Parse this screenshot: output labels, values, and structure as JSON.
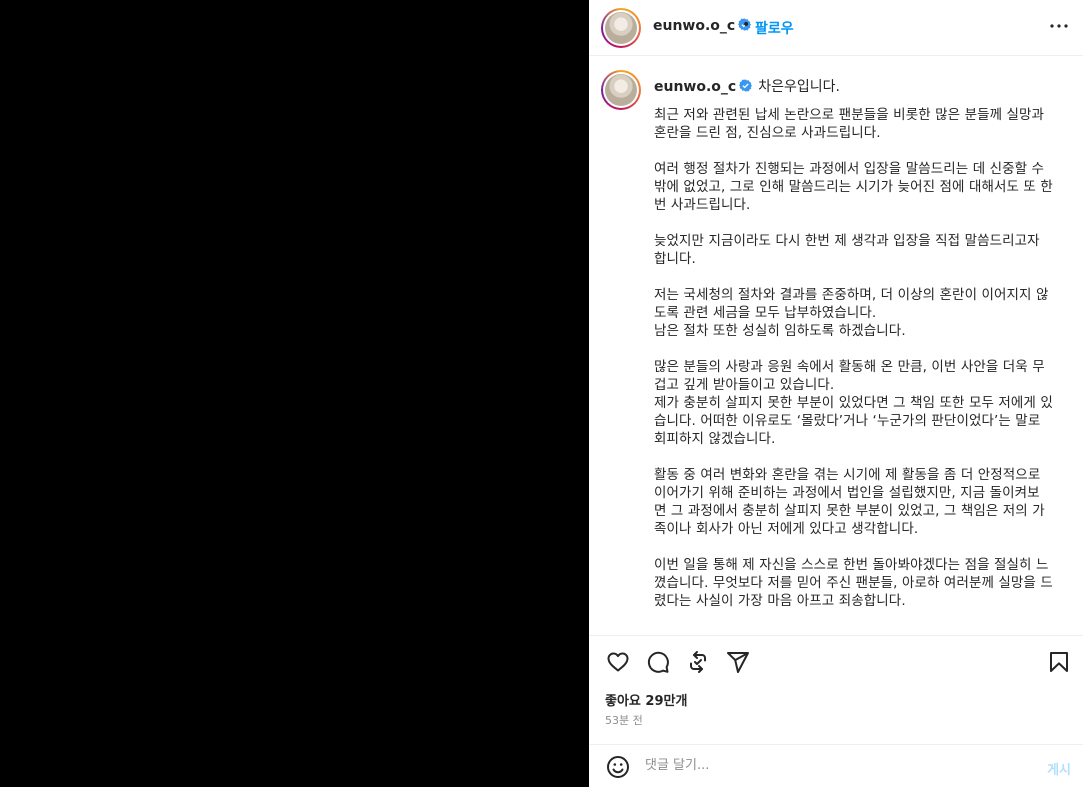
{
  "post": {
    "username": "eunwo.o_c",
    "follow_label": "팔로우",
    "header_separator": "•"
  },
  "caption": {
    "first_line": "차은우입니다.",
    "body": "최근 저와 관련된 납세 논란으로 팬분들을 비롯한 많은 분들께 실망과\n혼란을 드린 점, 진심으로 사과드립니다.\n\n여러 행정 절차가 진행되는 과정에서 입장을 말씀드리는 데 신중할 수\n밖에 없었고, 그로 인해 말씀드리는 시기가 늦어진 점에 대해서도 또 한\n번 사과드립니다.\n\n늦었지만 지금이라도 다시 한번 제 생각과 입장을 직접 말씀드리고자\n합니다.\n\n저는 국세청의 절차와 결과를 존중하며, 더 이상의 혼란이 이어지지 않\n도록 관련 세금을 모두 납부하였습니다.\n남은 절차 또한 성실히 임하도록 하겠습니다.\n\n많은 분들의 사랑과 응원 속에서 활동해 온 만큼, 이번 사안을 더욱 무\n겁고 깊게 받아들이고 있습니다.\n제가 충분히 살피지 못한 부분이 있었다면 그 책임 또한 모두 저에게 있\n습니다. 어떠한 이유로도 ‘몰랐다’거나 ‘누군가의 판단이었다’는 말로\n회피하지 않겠습니다.\n\n활동 중 여러 변화와 혼란을 겪는 시기에 제 활동을 좀 더 안정적으로\n이어가기 위해 준비하는 과정에서 법인을 설립했지만, 지금 돌이켜보\n면 그 과정에서 충분히 살피지 못한 부분이 있었고, 그 책임은 저의 가\n족이나 회사가 아닌 저에게 있다고 생각합니다.\n\n이번 일을 통해 제 자신을 스스로 한번 돌아봐야겠다는 점을 절실히 느\n꼈습니다. 무엇보다 저를 믿어 주신 팬분들, 아로하 여러분께 실망을 드\n렸다는 사실이 가장 마음 아프고 죄송합니다."
  },
  "stats": {
    "likes": "좋아요 29만개",
    "time_ago": "53분 전"
  },
  "comment": {
    "placeholder": "댓글 달기...",
    "post_label": "게시"
  },
  "icons": {
    "like": "heart-icon",
    "comment": "comment-icon",
    "repost": "repost-icon",
    "share": "share-icon",
    "save": "bookmark-icon",
    "more": "more-options-icon",
    "emoji": "emoji-icon",
    "verified": "verified-badge-icon"
  },
  "colors": {
    "link": "#0095f6",
    "verified": "#3897f0",
    "secondary_text": "#8e8e8e",
    "media_background": "#000000"
  }
}
